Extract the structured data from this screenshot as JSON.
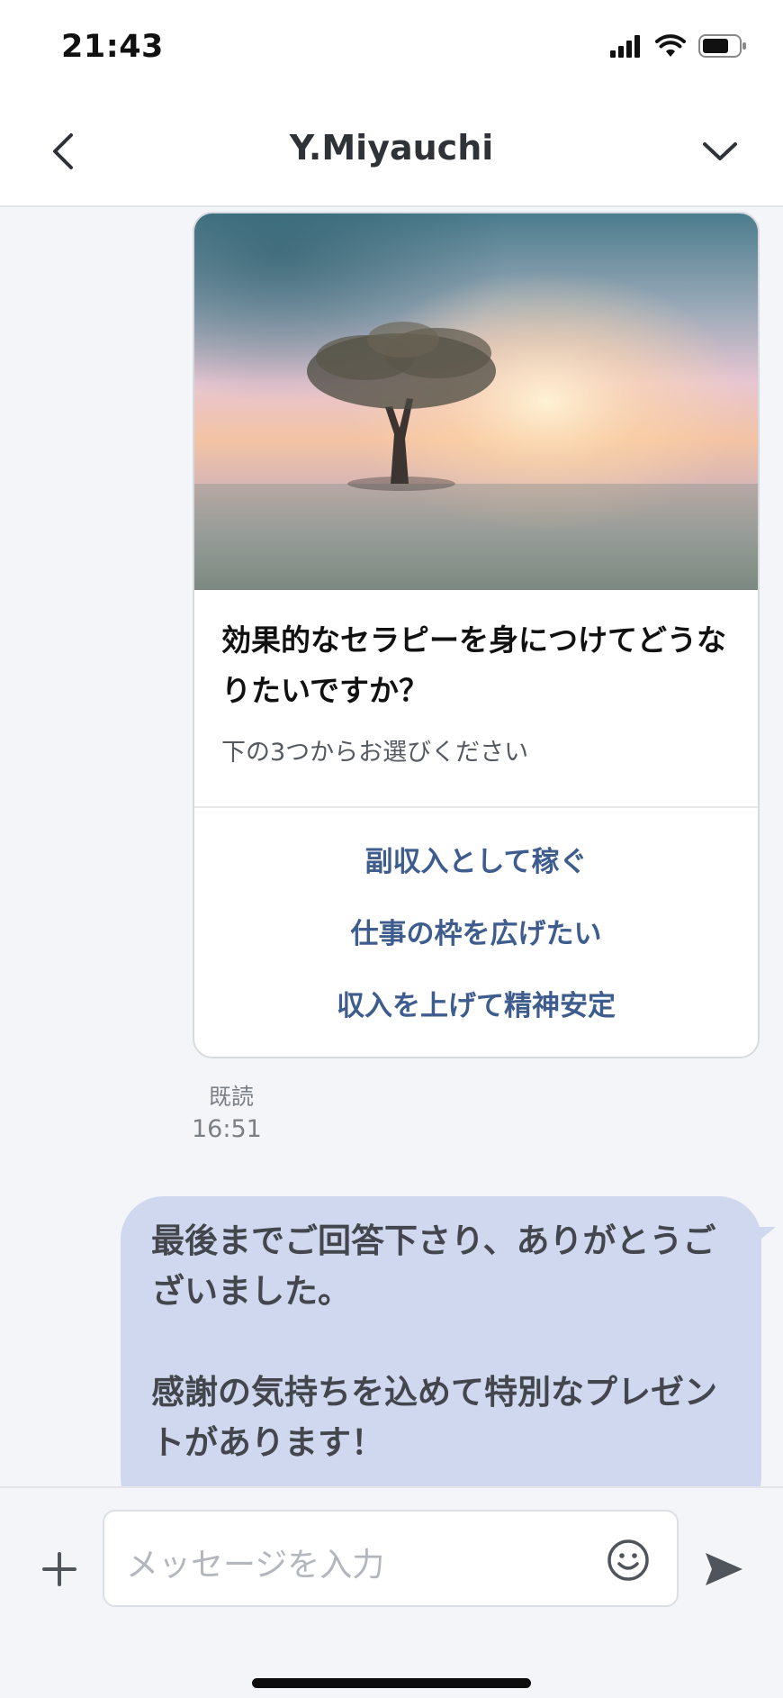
{
  "status_bar": {
    "time": "21:43",
    "icons": [
      "signal-icon",
      "wifi-icon",
      "battery-icon"
    ]
  },
  "header": {
    "title": "Y.Miyauchi",
    "back_icon": "chevron-left-icon",
    "menu_icon": "chevron-down-icon"
  },
  "card": {
    "image_icon": "tree-sunset-image",
    "title": "効果的なセラピーを身につけてどうなりたいですか？",
    "subtitle": "下の3つからお選びください",
    "actions": [
      {
        "label": "副収入として稼ぐ"
      },
      {
        "label": "仕事の枠を広げたい"
      },
      {
        "label": "収入を上げて精神安定"
      }
    ]
  },
  "message_meta": {
    "read": "既読",
    "time": "16:51"
  },
  "outgoing_message": {
    "text": "最後までご回答下さり、ありがとうございました。\n\n感謝の気持ちを込めて特別なプレゼントがあります！"
  },
  "input_bar": {
    "placeholder": "メッセージを入力",
    "plus_icon": "plus-icon",
    "emoji_icon": "smiley-icon",
    "send_icon": "send-icon"
  },
  "colors": {
    "accent_link": "#3e5d8e",
    "bubble_bg": "#cfd8ef",
    "chat_bg": "#f4f5f8"
  }
}
